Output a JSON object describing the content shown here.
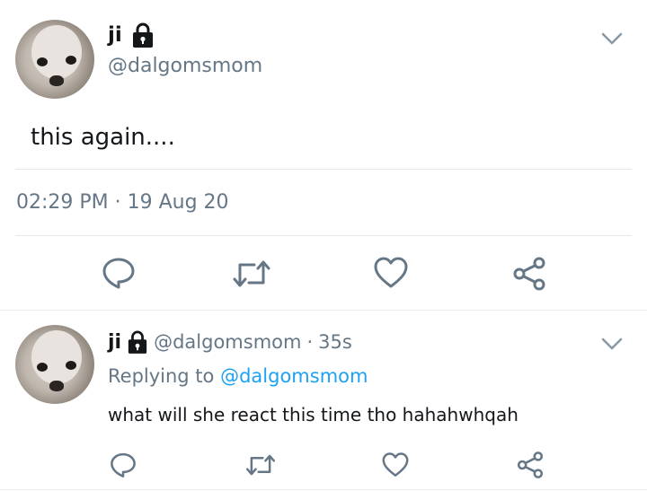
{
  "main_tweet": {
    "display_name": "ji",
    "handle": "@dalgomsmom",
    "text": "this again....",
    "timestamp": "02:29 PM · 19 Aug 20",
    "locked_icon": "lock-icon",
    "actions": [
      "reply-icon",
      "retweet-icon",
      "like-icon",
      "share-icon"
    ]
  },
  "reply_tweet": {
    "display_name": "ji",
    "handle": "@dalgomsmom",
    "dot": "·",
    "age": "35s",
    "replying_prefix": "Replying to",
    "replying_handle": "@dalgomsmom",
    "text": "what will she react this time tho hahahwhqah",
    "locked_icon": "lock-icon",
    "actions": [
      "reply-icon",
      "retweet-icon",
      "like-icon",
      "share-icon"
    ]
  },
  "colors": {
    "text": "#14171a",
    "secondary": "#657786",
    "link": "#1da1f2",
    "divider": "#e1e8ed"
  }
}
